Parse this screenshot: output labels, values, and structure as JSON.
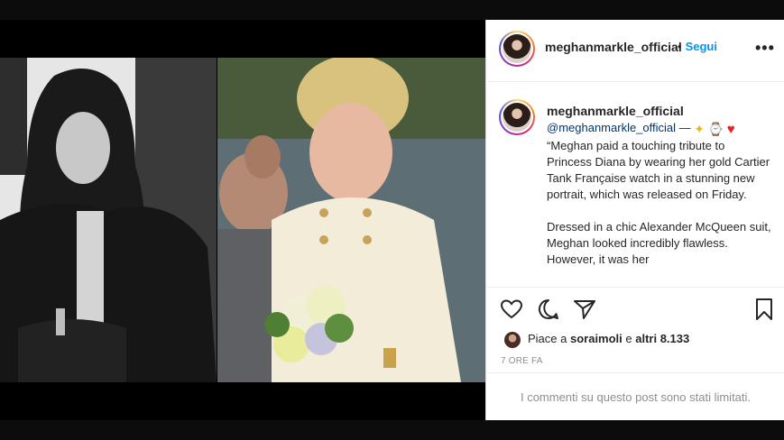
{
  "post": {
    "username": "meghanmarkle_official",
    "follow_separator": "•",
    "follow_label": "Segui",
    "more_label": "•••"
  },
  "caption": {
    "username": "meghanmarkle_official",
    "mention": "@meghanmarkle_official",
    "dash": " — ",
    "body": "“Meghan paid a touching tribute to Princess Diana by wearing her gold Cartier Tank Française watch in a stunning new portrait, which was released on Friday.\n\nDressed in a chic Alexander McQueen suit, Meghan looked incredibly flawless. However, it was her",
    "emoji_star": "✦",
    "emoji_heart": "♥"
  },
  "actions": {
    "likes_prefix": "Piace a ",
    "likes_user": "soraimoli",
    "likes_mid": " e ",
    "likes_count": "altri 8.133",
    "time": "7 ORE FA",
    "comments_limited": "I commenti su questo post sono stati limitati."
  },
  "icons": [
    "heart-icon",
    "comment-icon",
    "share-icon",
    "bookmark-icon",
    "more-options-icon"
  ],
  "colors": {
    "link": "#0095f6",
    "mention": "#00376b",
    "text": "#262626",
    "muted": "#8e8e8e"
  }
}
